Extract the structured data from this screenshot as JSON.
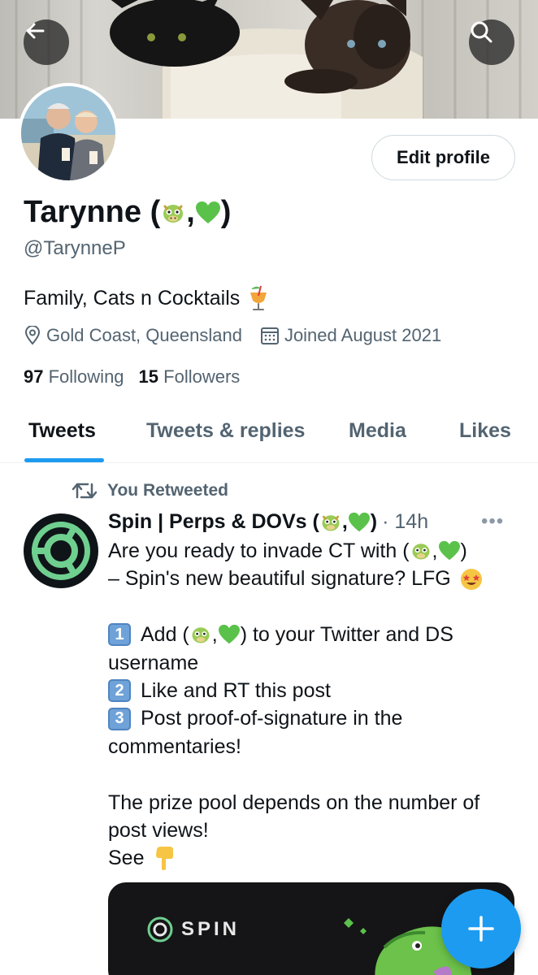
{
  "header": {
    "back_icon": "arrow-left-icon",
    "search_icon": "search-icon"
  },
  "profile": {
    "name_text": "Tarynne (",
    "name_comma": ",",
    "name_close": ")",
    "handle": "@TarynneP",
    "edit_label": "Edit profile",
    "bio_text": "Family, Cats n Cocktails",
    "location": "Gold Coast, Queensland",
    "joined": "Joined August 2021",
    "following_count": "97",
    "following_label": "Following",
    "followers_count": "15",
    "followers_label": "Followers"
  },
  "tabs": [
    {
      "label": "Tweets",
      "active": true
    },
    {
      "label": "Tweets & replies",
      "active": false
    },
    {
      "label": "Media",
      "active": false
    },
    {
      "label": "Likes",
      "active": false
    }
  ],
  "tweet": {
    "retweet_label": "You Retweeted",
    "author_text": "Spin | Perps & DOVs (",
    "author_comma": ",",
    "author_close": ")",
    "time": "· 14h",
    "more": "•••",
    "line1_a": "Are you ready to invade CT with (",
    "line1_b": ",",
    "line1_c": ")",
    "line2": "– Spin's new beautiful signature? LFG",
    "step1_num": "1",
    "step1_a": "Add (",
    "step1_b": ",",
    "step1_c": ") to your Twitter and DS",
    "step1_d": "username",
    "step2_num": "2",
    "step2": "Like and RT this post",
    "step3_num": "3",
    "step3_a": "Post proof-of-signature in the",
    "step3_b": "commentaries!",
    "prize_a": "The prize pool depends on the number of",
    "prize_b": "post views!",
    "see": "See",
    "media_logo_text": "SPIN"
  },
  "colors": {
    "accent": "#1d9bf0",
    "secondary_text": "#536471",
    "primary_text": "#0f1419"
  }
}
